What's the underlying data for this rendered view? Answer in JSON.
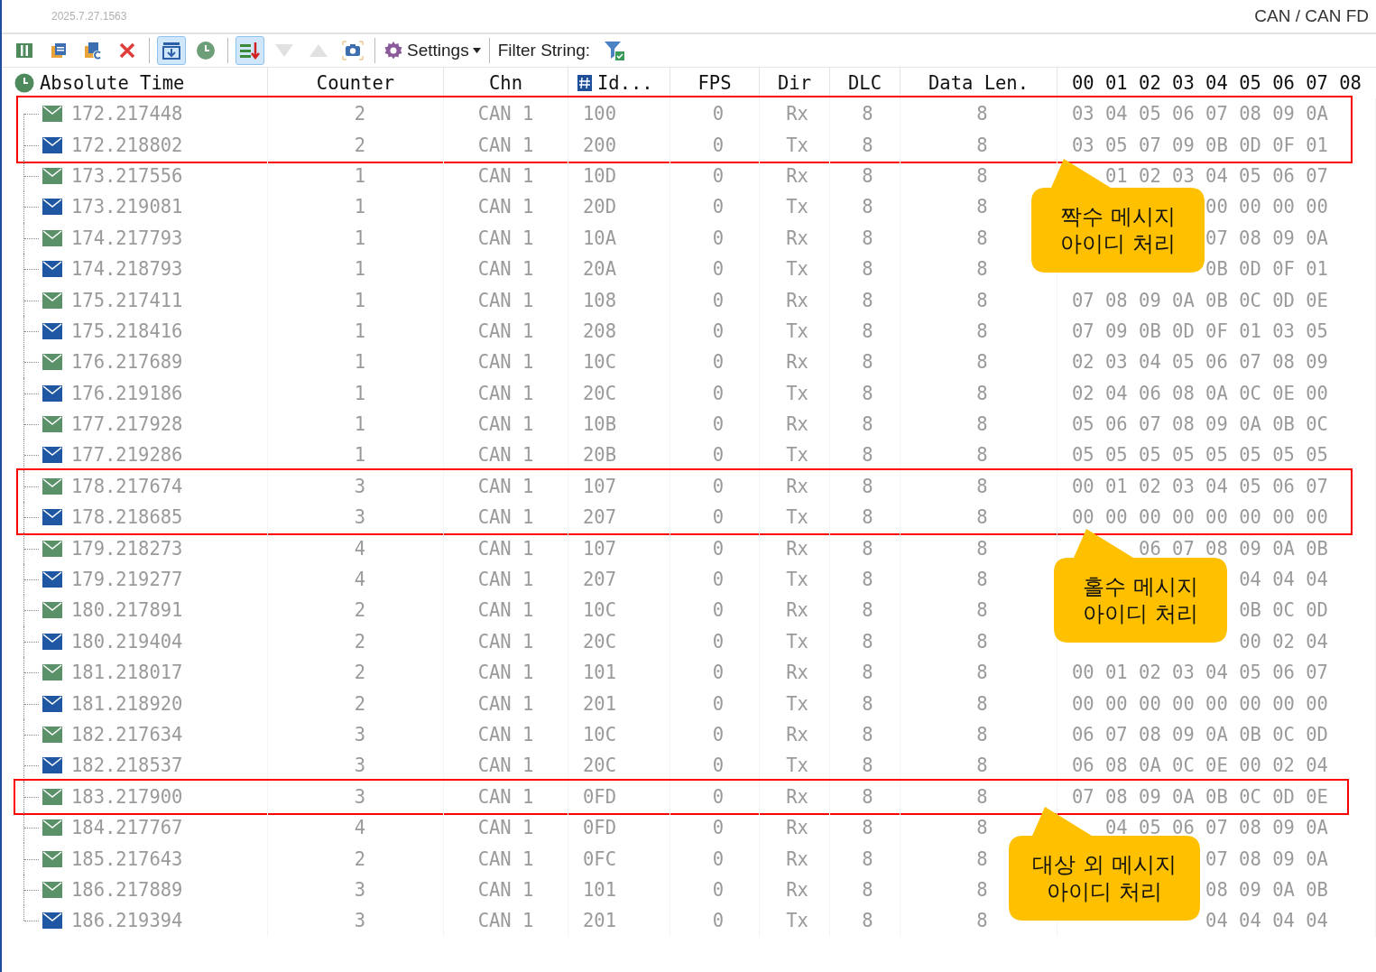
{
  "titlebar": {
    "version": "2025.7.27.1563",
    "title": "CAN / CAN FD"
  },
  "toolbar": {
    "buttons": [
      {
        "selected": false,
        "disabled": false
      },
      {
        "selected": false,
        "disabled": false
      },
      {
        "selected": false,
        "disabled": false
      },
      {
        "selected": false,
        "disabled": false
      },
      {
        "selected": true,
        "disabled": false
      },
      {
        "selected": false,
        "disabled": false
      },
      {
        "selected": true,
        "disabled": false
      },
      {
        "selected": false,
        "disabled": true
      },
      {
        "selected": false,
        "disabled": true
      },
      {
        "selected": false,
        "disabled": false
      }
    ],
    "settings_label": "Settings",
    "filter_label": "Filter String:"
  },
  "columns": [
    "Absolute Time",
    "Counter",
    "Chn",
    "Id...",
    "FPS",
    "Dir",
    "DLC",
    "Data Len.",
    "00 01 02 03 04 05 06 07 08"
  ],
  "rows": [
    {
      "kind": "rx",
      "time": "172.217448",
      "counter": "2",
      "chn": "CAN 1",
      "id": "100",
      "fps": "0",
      "dir": "Rx",
      "dlc": "8",
      "len": "8",
      "data": "03 04 05 06 07 08 09 0A",
      "outlined": true
    },
    {
      "kind": "tx",
      "time": "172.218802",
      "counter": "2",
      "chn": "CAN 1",
      "id": "200",
      "fps": "0",
      "dir": "Tx",
      "dlc": "8",
      "len": "8",
      "data": "03 05 07 09 0B 0D 0F 01",
      "outlined": true
    },
    {
      "kind": "rx",
      "time": "173.217556",
      "counter": "1",
      "chn": "CAN 1",
      "id": "10D",
      "fps": "0",
      "dir": "Rx",
      "dlc": "8",
      "len": "8",
      "data": "01 02 03 04 05 06 07",
      "outlined": false
    },
    {
      "kind": "tx",
      "time": "173.219081",
      "counter": "1",
      "chn": "CAN 1",
      "id": "20D",
      "fps": "0",
      "dir": "Tx",
      "dlc": "8",
      "len": "8",
      "data": "00 00 00 00",
      "outlined": false
    },
    {
      "kind": "rx",
      "time": "174.217793",
      "counter": "1",
      "chn": "CAN 1",
      "id": "10A",
      "fps": "0",
      "dir": "Rx",
      "dlc": "8",
      "len": "8",
      "data": "07 08 09 0A",
      "outlined": false
    },
    {
      "kind": "tx",
      "time": "174.218793",
      "counter": "1",
      "chn": "CAN 1",
      "id": "20A",
      "fps": "0",
      "dir": "Tx",
      "dlc": "8",
      "len": "8",
      "data": "0B 0D 0F 01",
      "outlined": false
    },
    {
      "kind": "rx",
      "time": "175.217411",
      "counter": "1",
      "chn": "CAN 1",
      "id": "108",
      "fps": "0",
      "dir": "Rx",
      "dlc": "8",
      "len": "8",
      "data": "07 08 09 0A 0B 0C 0D 0E",
      "outlined": false
    },
    {
      "kind": "tx",
      "time": "175.218416",
      "counter": "1",
      "chn": "CAN 1",
      "id": "208",
      "fps": "0",
      "dir": "Tx",
      "dlc": "8",
      "len": "8",
      "data": "07 09 0B 0D 0F 01 03 05",
      "outlined": false
    },
    {
      "kind": "rx",
      "time": "176.217689",
      "counter": "1",
      "chn": "CAN 1",
      "id": "10C",
      "fps": "0",
      "dir": "Rx",
      "dlc": "8",
      "len": "8",
      "data": "02 03 04 05 06 07 08 09",
      "outlined": false
    },
    {
      "kind": "tx",
      "time": "176.219186",
      "counter": "1",
      "chn": "CAN 1",
      "id": "20C",
      "fps": "0",
      "dir": "Tx",
      "dlc": "8",
      "len": "8",
      "data": "02 04 06 08 0A 0C 0E 00",
      "outlined": false
    },
    {
      "kind": "rx",
      "time": "177.217928",
      "counter": "1",
      "chn": "CAN 1",
      "id": "10B",
      "fps": "0",
      "dir": "Rx",
      "dlc": "8",
      "len": "8",
      "data": "05 06 07 08 09 0A 0B 0C",
      "outlined": false
    },
    {
      "kind": "tx",
      "time": "177.219286",
      "counter": "1",
      "chn": "CAN 1",
      "id": "20B",
      "fps": "0",
      "dir": "Tx",
      "dlc": "8",
      "len": "8",
      "data": "05 05 05 05 05 05 05 05",
      "outlined": false
    },
    {
      "kind": "rx",
      "time": "178.217674",
      "counter": "3",
      "chn": "CAN 1",
      "id": "107",
      "fps": "0",
      "dir": "Rx",
      "dlc": "8",
      "len": "8",
      "data": "00 01 02 03 04 05 06 07",
      "outlined": true
    },
    {
      "kind": "tx",
      "time": "178.218685",
      "counter": "3",
      "chn": "CAN 1",
      "id": "207",
      "fps": "0",
      "dir": "Tx",
      "dlc": "8",
      "len": "8",
      "data": "00 00 00 00 00 00 00 00",
      "outlined": true
    },
    {
      "kind": "rx",
      "time": "179.218273",
      "counter": "4",
      "chn": "CAN 1",
      "id": "107",
      "fps": "0",
      "dir": "Rx",
      "dlc": "8",
      "len": "8",
      "data": "06 07 08 09 0A 0B",
      "outlined": false
    },
    {
      "kind": "tx",
      "time": "179.219277",
      "counter": "4",
      "chn": "CAN 1",
      "id": "207",
      "fps": "0",
      "dir": "Tx",
      "dlc": "8",
      "len": "8",
      "data": "04 04 04",
      "outlined": false
    },
    {
      "kind": "rx",
      "time": "180.217891",
      "counter": "2",
      "chn": "CAN 1",
      "id": "10C",
      "fps": "0",
      "dir": "Rx",
      "dlc": "8",
      "len": "8",
      "data": "0B 0C 0D",
      "outlined": false
    },
    {
      "kind": "tx",
      "time": "180.219404",
      "counter": "2",
      "chn": "CAN 1",
      "id": "20C",
      "fps": "0",
      "dir": "Tx",
      "dlc": "8",
      "len": "8",
      "data": "00 02 04",
      "outlined": false
    },
    {
      "kind": "rx",
      "time": "181.218017",
      "counter": "2",
      "chn": "CAN 1",
      "id": "101",
      "fps": "0",
      "dir": "Rx",
      "dlc": "8",
      "len": "8",
      "data": "00 01 02 03 04 05 06 07",
      "outlined": false
    },
    {
      "kind": "tx",
      "time": "181.218920",
      "counter": "2",
      "chn": "CAN 1",
      "id": "201",
      "fps": "0",
      "dir": "Tx",
      "dlc": "8",
      "len": "8",
      "data": "00 00 00 00 00 00 00 00",
      "outlined": false
    },
    {
      "kind": "rx",
      "time": "182.217634",
      "counter": "3",
      "chn": "CAN 1",
      "id": "10C",
      "fps": "0",
      "dir": "Rx",
      "dlc": "8",
      "len": "8",
      "data": "06 07 08 09 0A 0B 0C 0D",
      "outlined": false
    },
    {
      "kind": "tx",
      "time": "182.218537",
      "counter": "3",
      "chn": "CAN 1",
      "id": "20C",
      "fps": "0",
      "dir": "Tx",
      "dlc": "8",
      "len": "8",
      "data": "06 08 0A 0C 0E 00 02 04",
      "outlined": false
    },
    {
      "kind": "rx",
      "time": "183.217900",
      "counter": "3",
      "chn": "CAN 1",
      "id": "0FD",
      "fps": "0",
      "dir": "Rx",
      "dlc": "8",
      "len": "8",
      "data": "07 08 09 0A 0B 0C 0D 0E",
      "outlined": true
    },
    {
      "kind": "rx",
      "time": "184.217767",
      "counter": "4",
      "chn": "CAN 1",
      "id": "0FD",
      "fps": "0",
      "dir": "Rx",
      "dlc": "8",
      "len": "8",
      "data": "04 05 06 07 08 09 0A",
      "outlined": false
    },
    {
      "kind": "rx",
      "time": "185.217643",
      "counter": "2",
      "chn": "CAN 1",
      "id": "0FC",
      "fps": "0",
      "dir": "Rx",
      "dlc": "8",
      "len": "8",
      "data": "07 08 09 0A",
      "outlined": false
    },
    {
      "kind": "rx",
      "time": "186.217889",
      "counter": "3",
      "chn": "CAN 1",
      "id": "101",
      "fps": "0",
      "dir": "Rx",
      "dlc": "8",
      "len": "8",
      "data": "08 09 0A 0B",
      "outlined": false
    },
    {
      "kind": "tx",
      "time": "186.219394",
      "counter": "3",
      "chn": "CAN 1",
      "id": "201",
      "fps": "0",
      "dir": "Tx",
      "dlc": "8",
      "len": "8",
      "data": "04 04 04 04",
      "outlined": false
    }
  ],
  "callouts": [
    {
      "text": "짝수 메시지\n아이디 처리"
    },
    {
      "text": "홀수 메시지\n아이디 처리"
    },
    {
      "text": "대상 외 메시지\n아이디 처리"
    }
  ]
}
